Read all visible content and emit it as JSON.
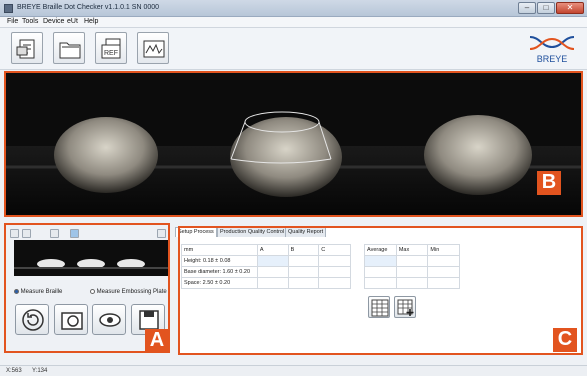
{
  "window": {
    "title": "BREYE Braille Dot Checker v1.1.0.1 SN 0000",
    "min_glyph": "–",
    "max_glyph": "□",
    "close_glyph": "✕"
  },
  "menu": [
    "File",
    "Tools",
    "Device",
    "eUt",
    "Help"
  ],
  "toolbar": {
    "buttons": [
      "new-document-icon",
      "open-folder-icon",
      "reference-icon",
      "chart-icon"
    ],
    "ref_text": "REF"
  },
  "logo": {
    "text": "BREYE",
    "color": "#1f4f9c",
    "accent": "#e2541f"
  },
  "panels": {
    "image_label": "B",
    "control_label": "A",
    "results_label": "C"
  },
  "controls": {
    "measure_braille": "Measure Braille",
    "measure_plate": "Measure Embossing Plate",
    "selected": "measure_braille",
    "buttons": [
      "refresh-icon",
      "camera-icon",
      "eye-icon",
      "save-icon"
    ]
  },
  "tabs": [
    "Setup Process",
    "Production Quality Control",
    "Quality Report"
  ],
  "active_tab": 0,
  "table": {
    "headers": [
      "mm",
      "A",
      "B",
      "C"
    ],
    "rows": [
      {
        "label": "Height: 0.18 ± 0.08",
        "a": "",
        "b": "",
        "c": ""
      },
      {
        "label": "Base diameter: 1.60 ± 0.20",
        "a": "",
        "b": "",
        "c": ""
      },
      {
        "label": "Space: 2.50 ± 0.20",
        "a": "",
        "b": "",
        "c": ""
      }
    ]
  },
  "stats": {
    "headers": [
      "Average",
      "Max",
      "Min"
    ]
  },
  "status": {
    "coord_x": "X:563",
    "coord_y": "Y:134"
  },
  "colors": {
    "highlight": "#e2541f",
    "accent": "#2c5fa8"
  }
}
